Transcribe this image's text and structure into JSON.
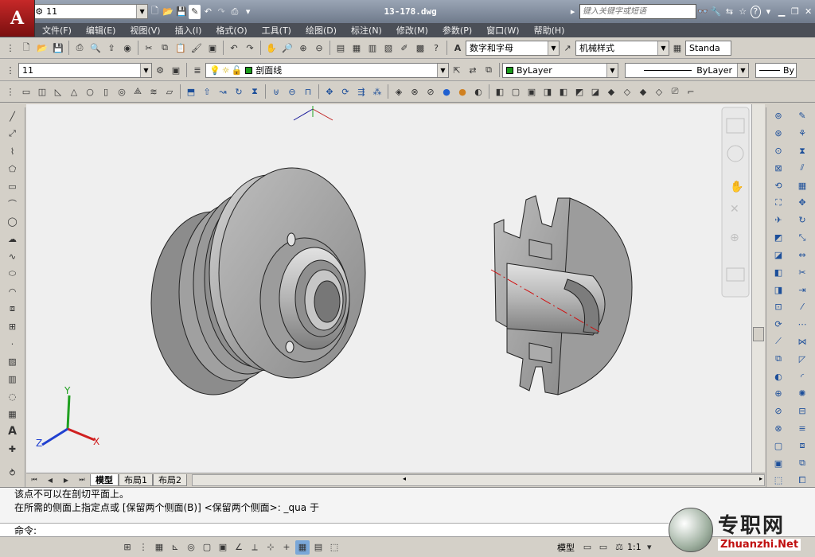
{
  "app": {
    "logo_letter": "A",
    "workspace": "11",
    "file_title": "13-178.dwg",
    "search_placeholder": "键入关键字或短语",
    "help_label": "?"
  },
  "menu": [
    "文件(F)",
    "编辑(E)",
    "视图(V)",
    "插入(I)",
    "格式(O)",
    "工具(T)",
    "绘图(D)",
    "标注(N)",
    "修改(M)",
    "参数(P)",
    "窗口(W)",
    "帮助(H)"
  ],
  "toolbar1": {
    "text_style": "数字和字母",
    "dim_style": "机械样式",
    "table_style": "Standa"
  },
  "toolbar2": {
    "workspace_combo": "11",
    "layer_combo": "剖面线",
    "color_combo": "ByLayer",
    "linetype_combo": "ByLayer",
    "lineweight_combo": "By"
  },
  "tabs": [
    "模型",
    "布局1",
    "布局2"
  ],
  "command": {
    "line1": "该点不可以在剖切平面上。",
    "line2": "在所需的侧面上指定点或 [保留两个侧面(B)] <保留两个侧面>: _qua 于",
    "prompt": "命令:"
  },
  "status": {
    "model_label": "模型",
    "scale": "1:1"
  },
  "watermark": {
    "cn": "专职网",
    "en": "Zhuanzhi.Net"
  },
  "ucs": {
    "x": "X",
    "y": "Y",
    "z": "Z"
  },
  "colors": {
    "layer_color": "#1a9a1a",
    "ucs_x": "#d02020",
    "ucs_y": "#20a020",
    "ucs_z": "#2040d0"
  }
}
